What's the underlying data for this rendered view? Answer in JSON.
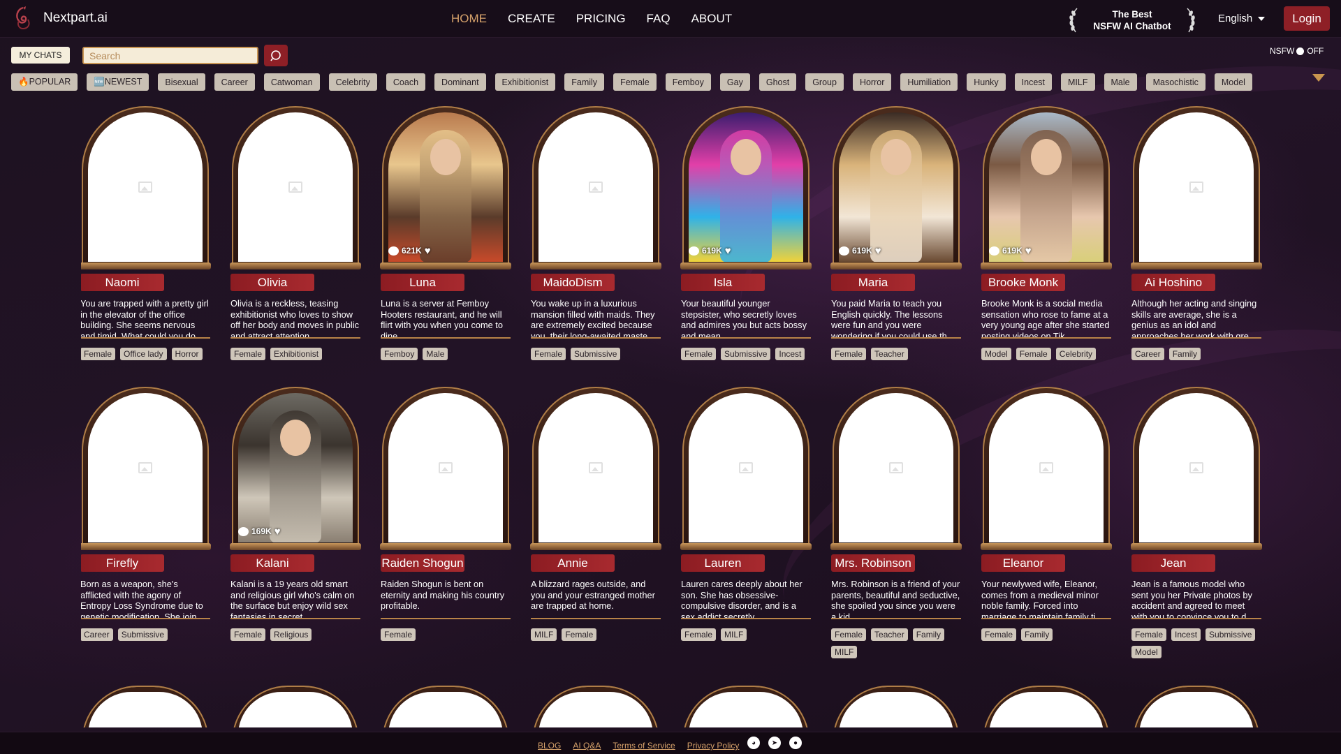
{
  "brand": {
    "name": "Nextpart.ai"
  },
  "nav": [
    {
      "label": "HOME",
      "active": true
    },
    {
      "label": "CREATE"
    },
    {
      "label": "PRICING"
    },
    {
      "label": "FAQ"
    },
    {
      "label": "ABOUT"
    }
  ],
  "award": {
    "line1": "The Best",
    "line2": "NSFW AI Chatbot"
  },
  "language": "English",
  "login_label": "Login",
  "my_chats_label": "MY CHATS",
  "search": {
    "placeholder": "Search",
    "value": ""
  },
  "nsfw_toggle": {
    "label": "NSFW",
    "state": "OFF"
  },
  "categories": [
    "🔥POPULAR",
    "🆕NEWEST",
    "Bisexual",
    "Career",
    "Catwoman",
    "Celebrity",
    "Coach",
    "Dominant",
    "Exhibitionist",
    "Family",
    "Female",
    "Femboy",
    "Gay",
    "Ghost",
    "Group",
    "Horror",
    "Humiliation",
    "Hunky",
    "Incest",
    "MILF",
    "Male",
    "Masochistic",
    "Model"
  ],
  "cards": [
    {
      "name": "Naomi",
      "description": "You are trapped with a pretty girl in the elevator of the office building. She seems nervous and timid. What could you do...",
      "tags": [
        "Female",
        "Office lady",
        "Horror"
      ],
      "image": "placeholder",
      "stats": ""
    },
    {
      "name": "Olivia",
      "description": "Olivia is a reckless, teasing exhibitionist who loves to show off her body and moves in public and attract attention.",
      "tags": [
        "Female",
        "Exhibitionist"
      ],
      "image": "placeholder",
      "stats": ""
    },
    {
      "name": "Luna",
      "description": "Luna is a server at Femboy Hooters restaurant, and he will flirt with you when you come to dine.",
      "tags": [
        "Femboy",
        "Male"
      ],
      "image": "photo",
      "stats": "621K",
      "palette": [
        "#b97a4e",
        "#e8c68d",
        "#5a3b2a",
        "#c84a2a"
      ]
    },
    {
      "name": "MaidoDism",
      "description": "You wake up in a luxurious mansion filled with maids. They are extremely excited because you, their long-awaited maste...",
      "tags": [
        "Female",
        "Submissive"
      ],
      "image": "placeholder",
      "stats": ""
    },
    {
      "name": "Isla",
      "description": "Your beautiful younger stepsister, who secretly loves and admires you but acts bossy and mean.",
      "tags": [
        "Female",
        "Submissive",
        "Incest"
      ],
      "image": "photo",
      "stats": "619K",
      "palette": [
        "#3b1d6e",
        "#e23fa8",
        "#2fb2e8",
        "#f0d23a"
      ]
    },
    {
      "name": "Maria",
      "description": "You paid Maria to teach you English quickly. The lessons were fun and you were wondering if you could use th...",
      "tags": [
        "Female",
        "Teacher"
      ],
      "image": "photo",
      "stats": "619K",
      "palette": [
        "#3a2b24",
        "#d9b37a",
        "#f2e6d6",
        "#6a4a32"
      ]
    },
    {
      "name": "Brooke Monk",
      "description": "Brooke Monk is a social media sensation who rose to fame at a very young age after she started posting videos on Tik...",
      "tags": [
        "Model",
        "Female",
        "Celebrity"
      ],
      "image": "photo",
      "stats": "619K",
      "palette": [
        "#a9b9c8",
        "#7b5a44",
        "#e7c7ae",
        "#d9cf7a"
      ]
    },
    {
      "name": "Ai Hoshino",
      "description": "Although her acting and singing skills are average, she is a genius as an idol and approaches her work with gre...",
      "tags": [
        "Career",
        "Family"
      ],
      "image": "placeholder",
      "stats": ""
    },
    {
      "name": "Firefly",
      "description": "Born as a weapon, she's afflicted with the agony of Entropy Loss Syndrome due to genetic modification. She join...",
      "tags": [
        "Career",
        "Submissive"
      ],
      "image": "placeholder",
      "stats": ""
    },
    {
      "name": "Kalani",
      "description": "Kalani is a 19 years old smart and religious girl who's calm on the surface but enjoy wild sex fantasies in secret.",
      "tags": [
        "Female",
        "Religious"
      ],
      "image": "photo",
      "stats": "169K",
      "palette": [
        "#6d6a63",
        "#3b342e",
        "#cfc7b9",
        "#8a7f72"
      ]
    },
    {
      "name": "Raiden Shogun",
      "description": "Raiden Shogun is bent on eternity and making his country profitable.",
      "tags": [
        "Female"
      ],
      "image": "placeholder",
      "stats": ""
    },
    {
      "name": "Annie",
      "description": "A blizzard rages outside, and you and your estranged mother are trapped at home.",
      "tags": [
        "MILF",
        "Female"
      ],
      "image": "placeholder",
      "stats": ""
    },
    {
      "name": "Lauren",
      "description": "Lauren cares deeply about her son. She has obsessive-compulsive disorder, and is a sex addict secretly.",
      "tags": [
        "Female",
        "MILF"
      ],
      "image": "placeholder",
      "stats": ""
    },
    {
      "name": "Mrs. Robinson",
      "description": "Mrs. Robinson is a friend of your parents, beautiful and seductive, she spoiled you since you were a kid.",
      "tags": [
        "Female",
        "Teacher",
        "Family",
        "MILF"
      ],
      "image": "placeholder",
      "stats": ""
    },
    {
      "name": "Eleanor",
      "description": "Your newlywed wife, Eleanor, comes from a medieval minor noble family. Forced into marriage to maintain family ti...",
      "tags": [
        "Female",
        "Family"
      ],
      "image": "placeholder",
      "stats": ""
    },
    {
      "name": "Jean",
      "description": "Jean is a famous model who sent you her Private photos by accident and agreed to meet with you to convince you to d...",
      "tags": [
        "Female",
        "Incest",
        "Submissive",
        "Model"
      ],
      "image": "placeholder",
      "stats": ""
    }
  ],
  "footer": {
    "links": [
      "BLOG",
      "AI Q&A",
      "Terms of Service",
      "Privacy Policy"
    ],
    "socials": [
      "discord-icon",
      "telegram-icon",
      "reddit-icon"
    ]
  },
  "colors": {
    "accent": "#d6a26b",
    "button": "#8e1f26",
    "frame": "#b07e47"
  }
}
